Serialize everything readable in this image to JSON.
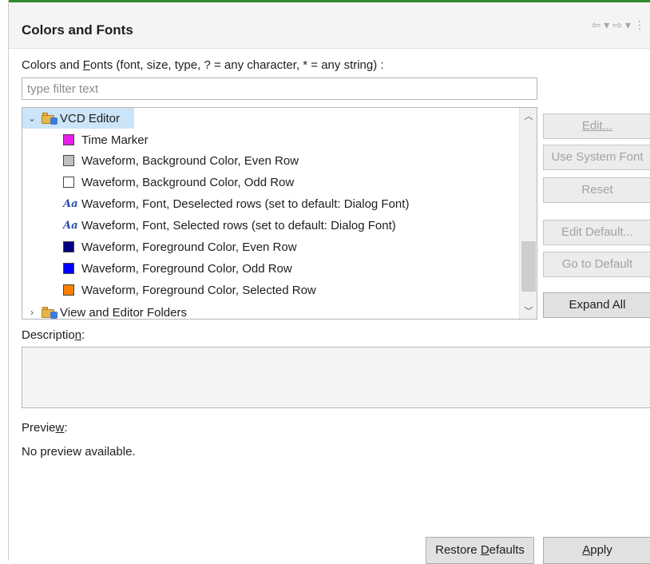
{
  "header": {
    "title": "Colors and Fonts",
    "nav_icons": [
      "back-arrow-icon",
      "dropdown-icon",
      "forward-arrow-icon",
      "dropdown-icon",
      "view-menu-icon"
    ]
  },
  "filter": {
    "label_before": "Colors and ",
    "label_mnemonic": "F",
    "label_after": "onts (font, size, type, ? = any character, * = any string) :",
    "placeholder": "type filter text",
    "value": ""
  },
  "tree": {
    "root_label": "VCD Editor",
    "items": [
      {
        "label": "Time Marker",
        "kind": "color",
        "color": "#e61ee6"
      },
      {
        "label": "Waveform, Background Color, Even Row",
        "kind": "color",
        "color": "#c0c0c0"
      },
      {
        "label": "Waveform, Background Color, Odd Row",
        "kind": "color",
        "color": "#ffffff"
      },
      {
        "label": "Waveform, Font, Deselected rows (set to default: Dialog Font)",
        "kind": "font",
        "glyph": "Aa"
      },
      {
        "label": "Waveform, Font, Selected rows (set to default: Dialog Font)",
        "kind": "font",
        "glyph": "Aa"
      },
      {
        "label": "Waveform, Foreground Color, Even Row",
        "kind": "color",
        "color": "#000080"
      },
      {
        "label": "Waveform, Foreground Color, Odd Row",
        "kind": "color",
        "color": "#0000ff"
      },
      {
        "label": "Waveform, Foreground Color, Selected Row",
        "kind": "color",
        "color": "#ff8000"
      }
    ],
    "next_folder_label": "View and Editor Folders"
  },
  "buttons": {
    "edit": "Edit...",
    "use_system_font": "Use System Font",
    "reset": "Reset",
    "edit_default": "Edit Default...",
    "go_to_default": "Go to Default",
    "expand_all": "Expand All"
  },
  "description": {
    "label_before": "Descriptio",
    "label_mnemonic": "n",
    "label_after": ":"
  },
  "preview": {
    "label_before": "Previe",
    "label_mnemonic": "w",
    "label_after": ":",
    "text": "No preview available."
  },
  "footer": {
    "restore_defaults_before": "Restore ",
    "restore_defaults_mnemonic": "D",
    "restore_defaults_after": "efaults",
    "apply_mnemonic": "A",
    "apply_after": "pply"
  },
  "colors": {
    "accent": "#2e8b2e",
    "selection": "#cce4f7"
  }
}
